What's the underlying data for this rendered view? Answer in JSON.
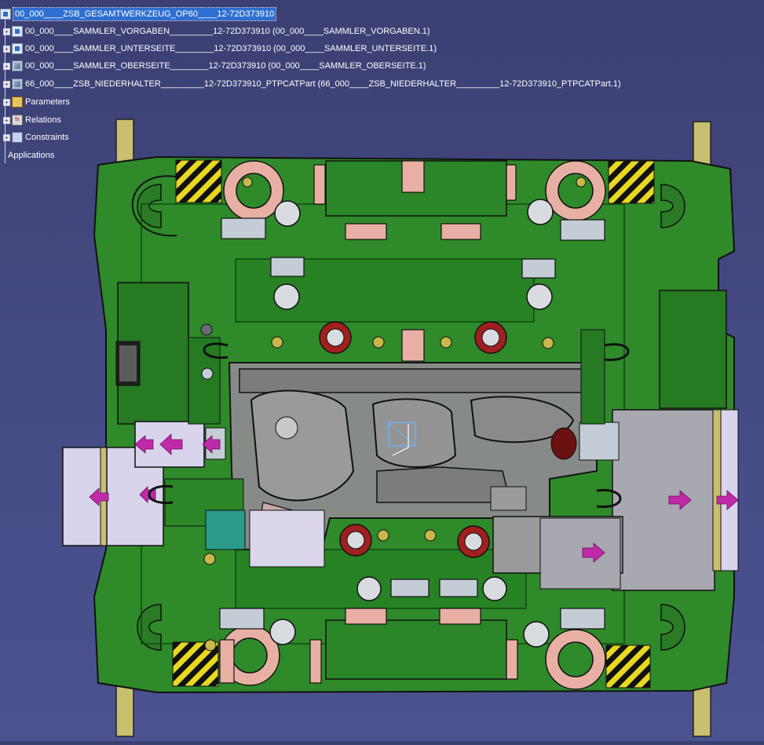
{
  "tree": {
    "root": {
      "label": "00_000____ZSB_GESAMTWERKZEUG_OP60____12-72D373910",
      "icon": "product-icon",
      "selected": true
    },
    "children": [
      {
        "label": "00_000____SAMMLER_VORGABEN_________12-72D373910 (00_000____SAMMLER_VORGABEN.1)",
        "icon": "product-icon"
      },
      {
        "label": "00_000____SAMMLER_UNTERSEITE________12-72D373910 (00_000____SAMMLER_UNTERSEITE.1)",
        "icon": "product-icon"
      },
      {
        "label": "00_000____SAMMLER_OBERSEITE________12-72D373910 (00_000____SAMMLER_OBERSEITE.1)",
        "icon": "part-icon"
      },
      {
        "label": "66_000____ZSB_NIEDERHALTER_________12-72D373910_PTPCATPart (66_000____ZSB_NIEDERHALTER_________12-72D373910_PTPCATPart.1)",
        "icon": "part-icon"
      },
      {
        "label": "Parameters",
        "icon": "parameters-icon"
      },
      {
        "label": "Relations",
        "icon": "relations-icon"
      },
      {
        "label": "Constraints",
        "icon": "constraints-icon"
      },
      {
        "label": "Applications",
        "icon": ""
      }
    ]
  },
  "colors": {
    "background": "#444a82",
    "plate_green": "#2f8a2a",
    "plate_dark": "#1f6a1c",
    "pink": "#e8b0a4",
    "grey_part": "#8c8c8c",
    "slider_lilac": "#d8d4ec",
    "arrow_magenta": "#c02aa8",
    "hazard_yellow": "#e8d820",
    "guide_pillar": "#c8c070",
    "selection_blue": "#2f6fd0"
  }
}
